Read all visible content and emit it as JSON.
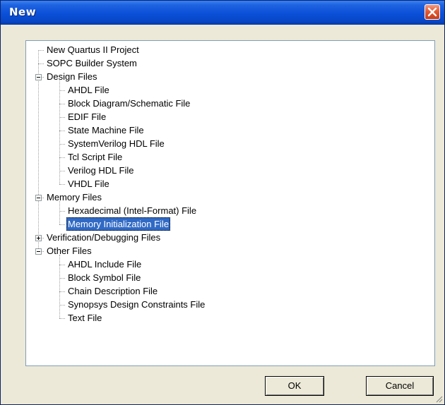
{
  "window": {
    "title": "New"
  },
  "tree": {
    "items": [
      {
        "label": "New Quartus II Project",
        "level": 0
      },
      {
        "label": "SOPC Builder System",
        "level": 0
      },
      {
        "label": "Design Files",
        "level": 0,
        "expander": "expanded"
      },
      {
        "label": "AHDL File",
        "level": 1
      },
      {
        "label": "Block Diagram/Schematic File",
        "level": 1
      },
      {
        "label": "EDIF File",
        "level": 1
      },
      {
        "label": "State Machine File",
        "level": 1
      },
      {
        "label": "SystemVerilog HDL File",
        "level": 1
      },
      {
        "label": "Tcl Script File",
        "level": 1
      },
      {
        "label": "Verilog HDL File",
        "level": 1
      },
      {
        "label": "VHDL File",
        "level": 1
      },
      {
        "label": "Memory Files",
        "level": 0,
        "expander": "expanded"
      },
      {
        "label": "Hexadecimal (Intel-Format) File",
        "level": 1
      },
      {
        "label": "Memory Initialization File",
        "level": 1,
        "selected": true
      },
      {
        "label": "Verification/Debugging Files",
        "level": 0,
        "expander": "collapsed"
      },
      {
        "label": "Other Files",
        "level": 0,
        "expander": "expanded"
      },
      {
        "label": "AHDL Include File",
        "level": 1
      },
      {
        "label": "Block Symbol File",
        "level": 1
      },
      {
        "label": "Chain Description File",
        "level": 1
      },
      {
        "label": "Synopsys Design Constraints File",
        "level": 1
      },
      {
        "label": "Text File",
        "level": 1
      }
    ]
  },
  "buttons": {
    "ok_label": "OK",
    "cancel_label": "Cancel"
  },
  "colors": {
    "selection": "#316ac5",
    "titlebar": "#0a4fd8",
    "close": "#e35a34",
    "dialog": "#ece9d8"
  },
  "icons": {
    "close": "close-icon",
    "expanded": "collapse-minus-icon",
    "collapsed": "expand-plus-icon",
    "grip": "resize-grip-icon"
  }
}
